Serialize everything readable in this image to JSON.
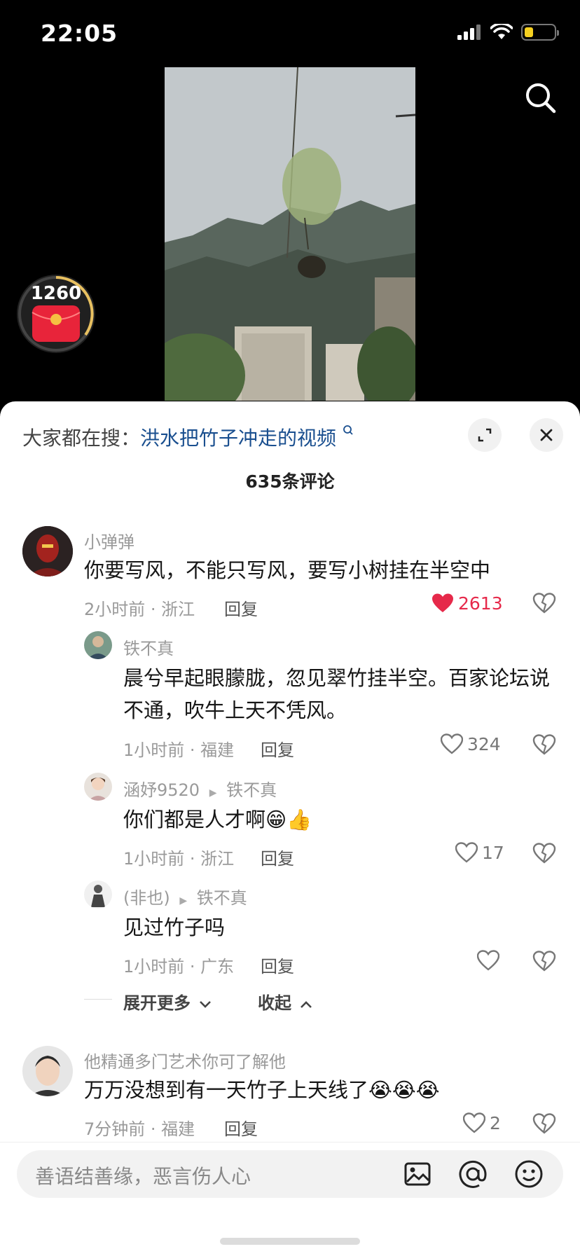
{
  "status": {
    "time": "22:05"
  },
  "coin": {
    "count": "1260"
  },
  "search_tip": {
    "prefix": "大家都在搜：",
    "query": "洪水把竹子冲走的视频"
  },
  "comment_count": "635条评论",
  "comments": [
    {
      "user": "小弹弹",
      "text": "你要写风，不能只写风，要写小树挂在半空中",
      "time": "2小时前 · 浙江",
      "reply": "回复",
      "likes": "2613"
    },
    {
      "user": "铁不真",
      "text": "晨兮早起眼朦胧，忽见翠竹挂半空。百家论坛说不通，吹牛上天不凭风。",
      "time": "1小时前 · 福建",
      "reply": "回复",
      "likes": "324"
    },
    {
      "user": "涵妤9520",
      "reply_to": "铁不真",
      "text": "你们都是人才啊😁👍",
      "time": "1小时前 · 浙江",
      "reply": "回复",
      "likes": "17"
    },
    {
      "user": "(非也)",
      "reply_to": "铁不真",
      "text": "见过竹子吗",
      "time": "1小时前 · 广东",
      "reply": "回复",
      "likes": ""
    },
    {
      "user": "他精通多门艺术你可了解他",
      "text": "万万没想到有一天竹子上天线了😭😭😭",
      "time": "7分钟前 · 福建",
      "reply": "回复",
      "likes": "2"
    }
  ],
  "expand": {
    "more": "展开更多",
    "collapse": "收起"
  },
  "input": {
    "placeholder": "善语结善缘，恶言伤人心"
  },
  "colors": {
    "like_red": "#e6294a",
    "link_blue": "#1a4f8f"
  }
}
